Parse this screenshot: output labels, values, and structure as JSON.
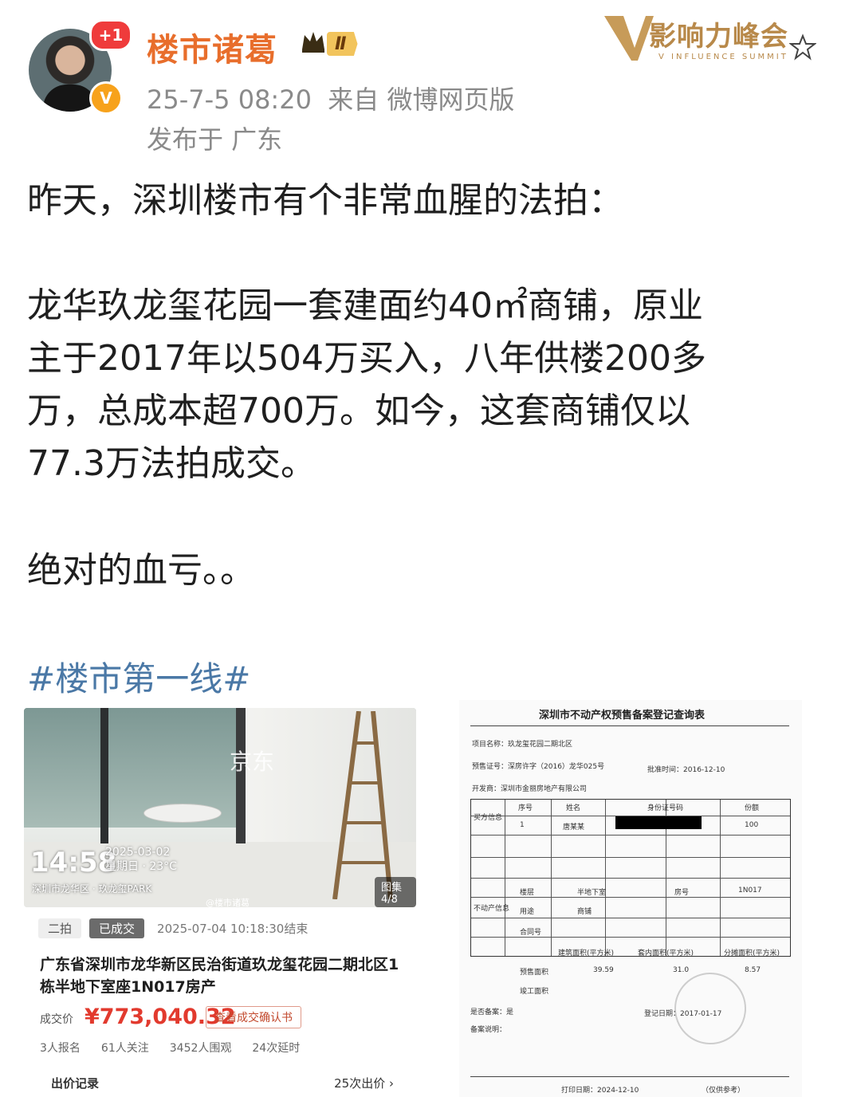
{
  "header": {
    "username": "楼市诸葛",
    "level": "Ⅱ",
    "notification_badge": "+1",
    "verified_icon": "verified-v-icon",
    "timestamp": "25-7-5 08:20",
    "source": "来自 微博网页版",
    "location": "发布于 广东",
    "summit_logo_title": "影响力峰会",
    "summit_logo_sub": "V INFLUENCE SUMMIT"
  },
  "post": {
    "paragraph1": "昨天，深圳楼市有个非常血腥的法拍：",
    "paragraph2_line1": "龙华玖龙玺花园一套建面约40㎡商铺，原业",
    "paragraph2_line2": "主于2017年以504万买入，八年供楼200多",
    "paragraph2_line3": "万，总成本超700万。如今，这套商铺仅以",
    "paragraph2_line4": "77.3万法拍成交。",
    "paragraph3": "绝对的血亏。。",
    "hashtag": "#楼市第一线#"
  },
  "auction_card": {
    "photo_watermark": "京东",
    "photo_time": "14:58",
    "photo_date": "2025-03-02",
    "photo_weather": "星期日 · 23°C",
    "photo_place": "深圳市龙华区 · 玖龙玺PARK",
    "photo_counter": "图集4/8",
    "photo_credit": "@楼市诸葛",
    "tag_round": "二拍",
    "tag_status": "已成交",
    "end_time": "2025-07-04 10:18:30结束",
    "address": "广东省深圳市龙华新区民治街道玖龙玺花园二期北区1栋半地下室座1N017房产",
    "price_label": "成交价",
    "price": "¥773,040.32",
    "confirm_button": "查看成交确认书",
    "stats": [
      "3人报名",
      "61人关注",
      "3452人围观",
      "24次延时"
    ],
    "bid_record_label": "出价记录",
    "bid_count": "25次出价 ›"
  },
  "document": {
    "title": "深圳市不动产权预售备案登记查询表",
    "project_label": "项目名称：",
    "project_value": "玖龙玺花园二期北区",
    "permit_label": "预售证号：",
    "permit_value": "深房许字（2016）龙华025号",
    "date_label": "批准时间：",
    "date_value": "2016-12-10",
    "developer_label": "开发商：",
    "developer_value": "深圳市金丽房地产有限公司",
    "buyer_label": "买方信息",
    "col_no": "序号",
    "col_name": "姓名",
    "col_id": "身份证号码",
    "col_share": "份额",
    "row_no": "1",
    "row_name": "唐某某",
    "row_share": "100",
    "property_label": "不动产信息",
    "use_label": "用途",
    "use_value": "商铺",
    "floor_label": "楼层",
    "floor_value": "半地下室",
    "room_label": "房号",
    "room_value": "1N017",
    "contract_label": "合同号",
    "area_label": "建筑面积(平方米)",
    "inner_area_label": "套内面积(平方米)",
    "shared_area_label": "分摊面积(平方米)",
    "presale_label": "预售面积",
    "area_value": "39.59",
    "inner_value": "31.0",
    "shared_value": "8.57",
    "complete_label": "竣工面积",
    "mortgage_label": "是否备案：是",
    "note_label": "备案说明：",
    "record_date_label": "登记日期：",
    "record_date": "2017-01-17",
    "print_date_label": "打印日期：",
    "print_date": "2024-12-10",
    "print_note": "（仅供参考）"
  }
}
